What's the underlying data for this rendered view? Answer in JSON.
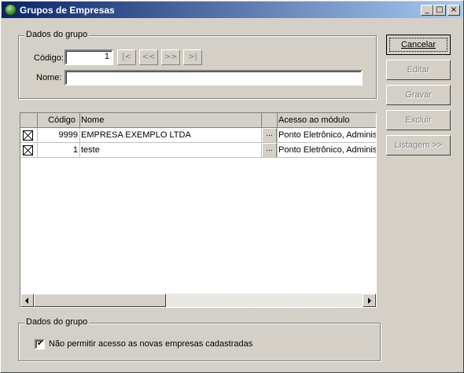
{
  "window": {
    "title": "Grupos de Empresas",
    "minimize_glyph": "_",
    "maximize_glyph": "□",
    "close_glyph": "×"
  },
  "group_top": {
    "legend": "Dados do grupo",
    "codigo_label": "Código:",
    "codigo_value": "1",
    "nome_label": "Nome:",
    "nome_value": "",
    "nav": {
      "first": "|<",
      "prev": "<<",
      "next": ">>",
      "last": ">|"
    }
  },
  "buttons": {
    "cancelar": "Cancelar",
    "editar": "Editar",
    "gravar": "Gravar",
    "excluir": "Excluir",
    "listagem": "Listagem >>"
  },
  "grid": {
    "columns": [
      "",
      "Código",
      "Nome",
      "",
      "Acesso ao módulo"
    ],
    "rows": [
      {
        "checked": true,
        "codigo": "9999",
        "nome": "EMPRESA EXEMPLO LTDA",
        "acesso": "Ponto Eletrônico, Administ"
      },
      {
        "checked": true,
        "codigo": "1",
        "nome": "teste",
        "acesso": "Ponto Eletrônico, Administ"
      }
    ],
    "ellipsis": "..."
  },
  "group_bottom": {
    "legend": "Dados do grupo",
    "checkbox_label": "Não permitir acesso as novas empresas cadastradas",
    "checkbox_checked": true,
    "tick": "✔"
  }
}
